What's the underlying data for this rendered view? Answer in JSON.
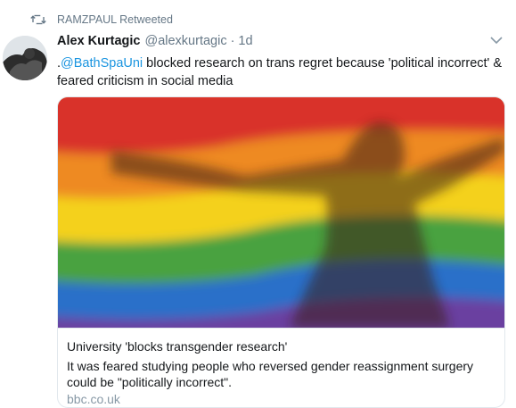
{
  "retweet": {
    "icon": "retweet-icon",
    "label": "RAMZPAUL Retweeted"
  },
  "tweet": {
    "author_name": "Alex Kurtagic",
    "author_handle": "@alexkurtagic",
    "separator": "·",
    "timestamp": "1d",
    "text_prefix": ".",
    "mention": "@BathSpaUni",
    "text_line1_rest": " blocked research on trans regret because 'political incorrect' &",
    "text_line2": "feared criticism in social media"
  },
  "card": {
    "title": "University 'blocks transgender research'",
    "description": "It was feared studying people who reversed gender reassignment surgery could be \"politically incorrect\".",
    "domain": "bbc.co.uk"
  },
  "colors": {
    "mention": "#1b95e0",
    "secondary_text": "#657786",
    "card_border": "#e1e8ed",
    "domain": "#8899a6"
  }
}
